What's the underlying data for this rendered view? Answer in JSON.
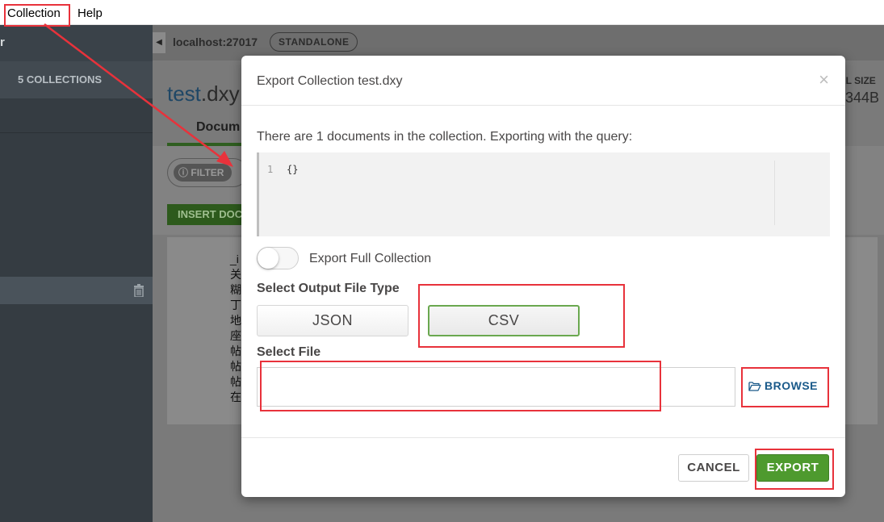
{
  "menu": {
    "items": [
      {
        "label": "Collection"
      },
      {
        "label": "Help"
      }
    ]
  },
  "sidebar": {
    "header_char": "r",
    "collections_count": "5 COLLECTIONS"
  },
  "topbar": {
    "host": "localhost:27017",
    "badge": "STANDALONE"
  },
  "collection": {
    "db": "test",
    "name": ".dxy",
    "tab": "Docum",
    "filter_label": "FILTER",
    "insert_label": "INSERT DOC",
    "size_label": "AL SIZE",
    "size_value": "344B",
    "doc_lines": [
      "_i",
      "关",
      "糊",
      "丁",
      "地",
      "座",
      "帖",
      "帖",
      "帖",
      "在"
    ]
  },
  "modal": {
    "title": "Export Collection test.dxy",
    "close": "×",
    "description": "There are 1 documents in the collection. Exporting with the query:",
    "query_line_number": "1",
    "query": "{}",
    "toggle_label": "Export Full Collection",
    "toggle_on": false,
    "file_type_label": "Select Output File Type",
    "file_types": [
      {
        "label": "JSON",
        "selected": false
      },
      {
        "label": "CSV",
        "selected": true
      }
    ],
    "select_file_label": "Select File",
    "file_value": "",
    "browse_label": "BROWSE",
    "cancel_label": "CANCEL",
    "export_label": "EXPORT"
  },
  "colors": {
    "accent_green": "#4e9a2e",
    "annotation_red": "#e8323b",
    "link_blue": "#1a5a8a"
  }
}
